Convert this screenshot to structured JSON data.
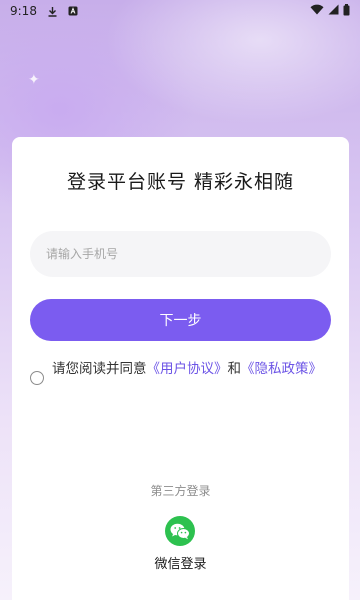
{
  "status_bar": {
    "time": "9:18",
    "icons_left": [
      "download-icon",
      "app-a-icon"
    ],
    "icons_right": [
      "wifi-icon",
      "signal-icon",
      "battery-icon"
    ]
  },
  "login": {
    "title": "登录平台账号 精彩永相随",
    "phone_placeholder": "请输入手机号",
    "phone_value": "",
    "next_button": "下一步",
    "agreement": {
      "prefix": "请您阅读并同意",
      "user_agreement": "《用户协议》",
      "and": "和",
      "privacy_policy": "《隐私政策》",
      "checked": false
    },
    "third_party_label": "第三方登录",
    "wechat_label": "微信登录"
  },
  "colors": {
    "accent": "#7b5cf0",
    "link": "#6c54e6",
    "wechat": "#2dc14f"
  }
}
